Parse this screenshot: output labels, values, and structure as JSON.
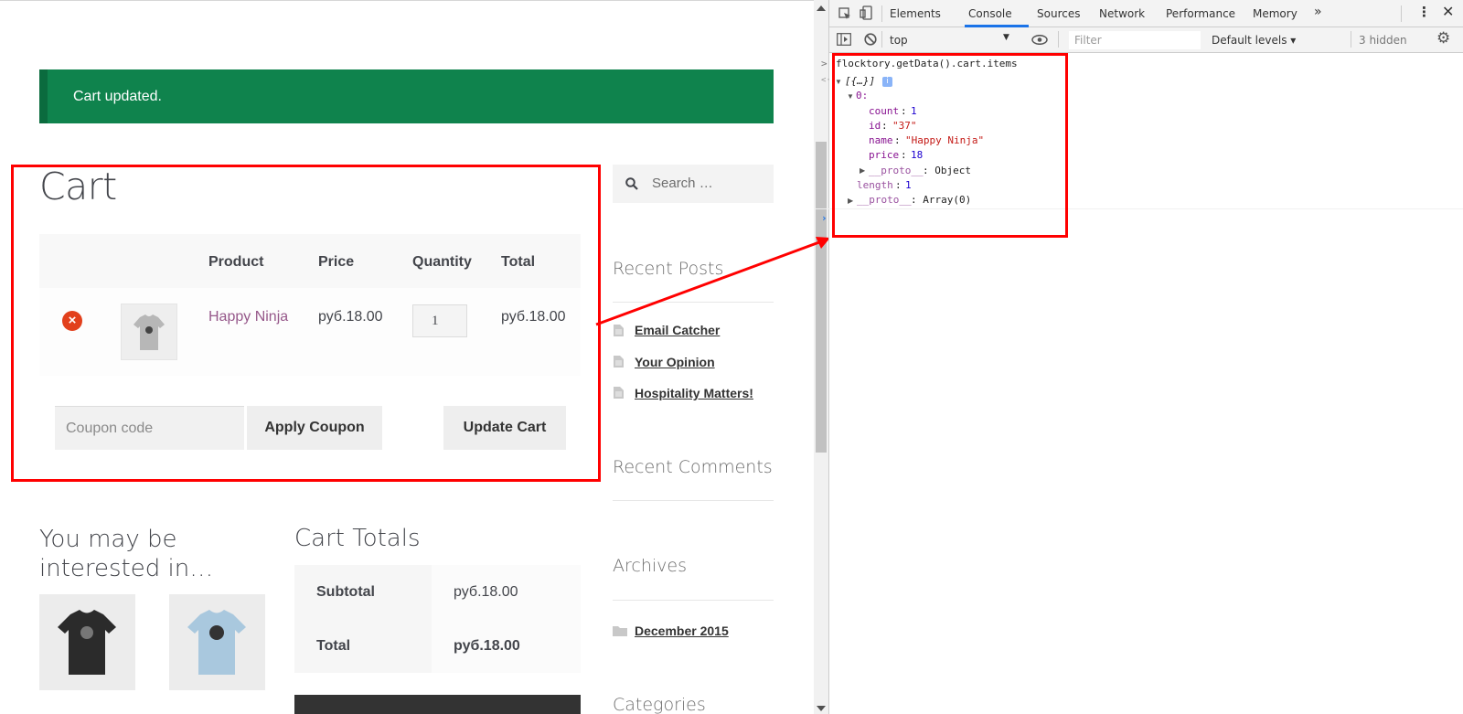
{
  "notice": "Cart updated.",
  "cart": {
    "title": "Cart",
    "headers": {
      "product": "Product",
      "price": "Price",
      "quantity": "Quantity",
      "total": "Total"
    },
    "item": {
      "name": "Happy Ninja",
      "price": "руб.18.00",
      "quantity": "1",
      "total": "руб.18.00"
    },
    "coupon_placeholder": "Coupon code",
    "apply_coupon": "Apply Coupon",
    "update_cart": "Update Cart"
  },
  "interested_title": "You may be interested in…",
  "totals": {
    "title": "Cart Totals",
    "subtotal_label": "Subtotal",
    "subtotal": "руб.18.00",
    "total_label": "Total",
    "total": "руб.18.00"
  },
  "sidebar": {
    "search_placeholder": "Search …",
    "recent_posts_title": "Recent Posts",
    "posts": [
      "Email Catcher",
      "Your Opinion",
      "Hospitality Matters!"
    ],
    "recent_comments_title": "Recent Comments",
    "archives_title": "Archives",
    "archive_month": "December 2015",
    "categories_title": "Categories"
  },
  "devtools": {
    "tabs": [
      "Elements",
      "Console",
      "Sources",
      "Network",
      "Performance",
      "Memory"
    ],
    "active_tab": "Console",
    "context": "top",
    "filter_placeholder": "Filter",
    "levels": "Default levels ▾",
    "hidden": "3 hidden",
    "command": "flocktory.getData().cart.items",
    "result_summary": "[{…}]",
    "index": "0:",
    "props": {
      "count_key": "count",
      "count_val": "1",
      "id_key": "id",
      "id_val": "\"37\"",
      "name_key": "name",
      "name_val": "\"Happy Ninja\"",
      "price_key": "price",
      "price_val": "18"
    },
    "proto_obj": "__proto__",
    "proto_obj_val": ": Object",
    "length_key": "length",
    "length_val": "1",
    "proto_arr": "__proto__",
    "proto_arr_val": ": Array(0)"
  },
  "colors": {
    "notice_bg": "#0f834d",
    "link": "#96588a",
    "highlight": "#ff0000",
    "remove": "#e2401c",
    "devtools_accent": "#1a73e8"
  }
}
